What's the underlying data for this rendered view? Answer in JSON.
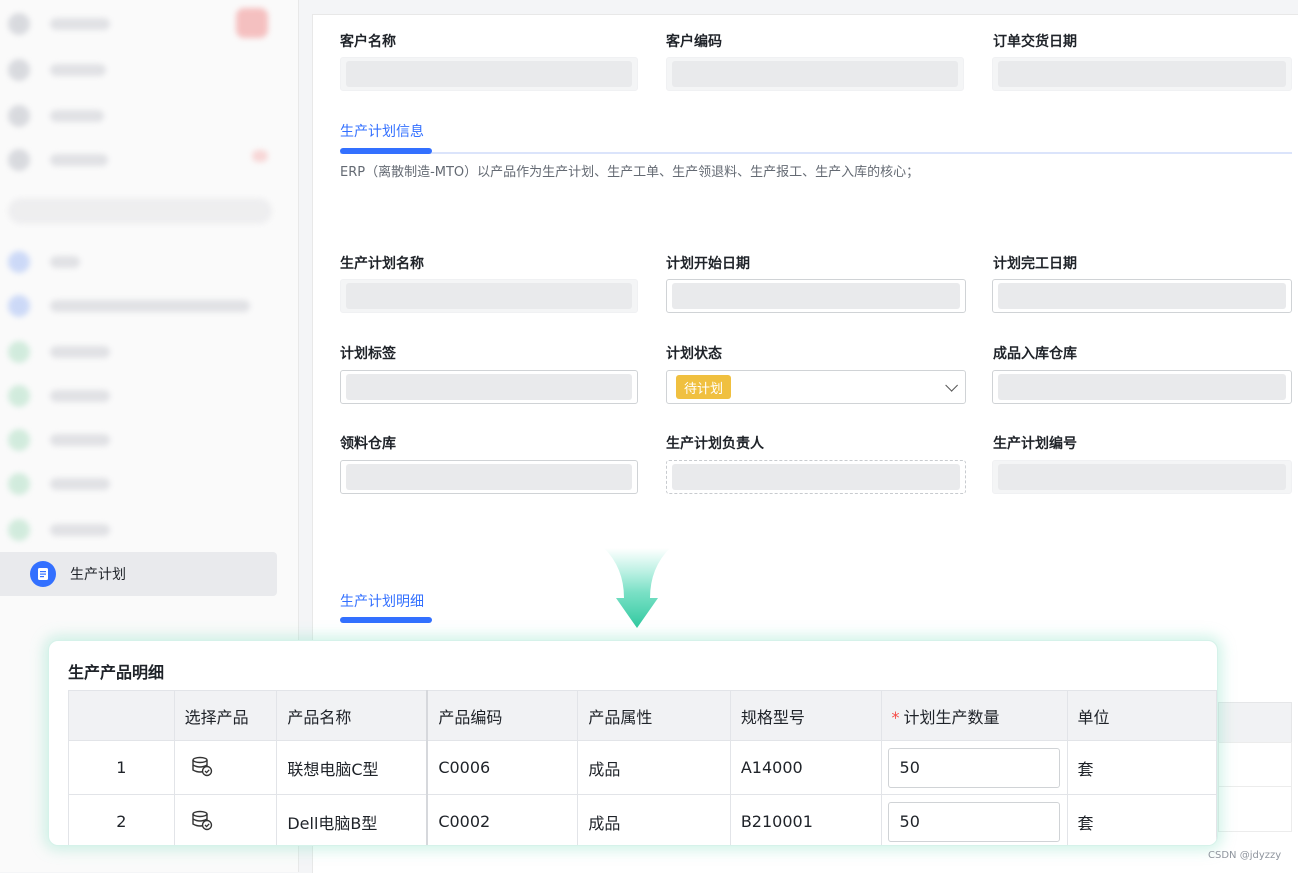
{
  "sidebar": {
    "active_item": {
      "label": "生产计划",
      "icon": "document-icon"
    },
    "colors": {
      "active_bg": "#e9eaed",
      "active_icon": "#3370ff"
    }
  },
  "form": {
    "row1": {
      "customer_name": "客户名称",
      "customer_code": "客户编码",
      "delivery_date": "订单交货日期"
    },
    "section_plan": {
      "title": "生产计划信息",
      "description": "ERP（离散制造-MTO）以产品作为生产计划、生产工单、生产领退料、生产报工、生产入库的核心；"
    },
    "labels": {
      "plan_name": "生产计划名称",
      "start_date": "计划开始日期",
      "end_date": "计划完工日期",
      "plan_tag": "计划标签",
      "plan_status": "计划状态",
      "warehouse_in": "成品入库仓库",
      "warehouse_pick": "领料仓库",
      "owner": "生产计划负责人",
      "plan_code": "生产计划编号"
    },
    "status_value": "待计划",
    "section_detail": {
      "title": "生产计划明细"
    }
  },
  "detail_card": {
    "title": "生产产品明细",
    "columns": [
      "",
      "选择产品",
      "产品名称",
      "产品编码",
      "产品属性",
      "规格型号",
      "计划生产数量",
      "单位"
    ],
    "required_mark": "*",
    "rows": [
      {
        "index": "1",
        "name": "联想电脑C型",
        "code": "C0006",
        "attr": "成品",
        "spec": "A14000",
        "qty": "50",
        "unit": "套"
      },
      {
        "index": "2",
        "name": "Dell电脑B型",
        "code": "C0002",
        "attr": "成品",
        "spec": "B210001",
        "qty": "50",
        "unit": "套"
      }
    ]
  },
  "watermark": "CSDN @jdyzzy",
  "colors": {
    "accent": "#3370ff",
    "status_tag": "#f0c040",
    "card_glow": "#78dcbe",
    "required": "#f54a45"
  }
}
